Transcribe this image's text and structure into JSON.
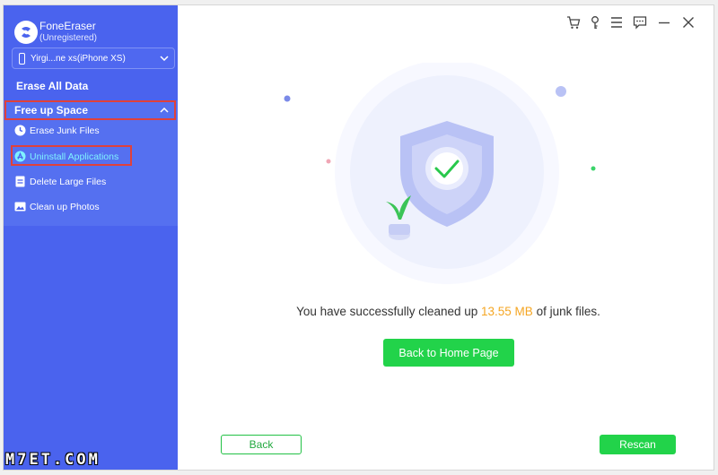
{
  "app": {
    "name": "FoneEraser",
    "status": "(Unregistered)"
  },
  "device": {
    "selected": "Yirgi...ne xs(iPhone XS)"
  },
  "sidebar": {
    "erase_all": "Erase All Data",
    "free_up": "Free up Space",
    "items": [
      {
        "label": "Erase Junk Files",
        "icon": "clock-icon"
      },
      {
        "label": "Uninstall Applications",
        "icon": "app-store-icon"
      },
      {
        "label": "Delete Large Files",
        "icon": "file-icon"
      },
      {
        "label": "Clean up Photos",
        "icon": "photo-icon"
      }
    ]
  },
  "toolbar": {
    "icons": [
      "cart-icon",
      "key-icon",
      "menu-icon",
      "feedback-icon",
      "minimize-icon",
      "close-icon"
    ]
  },
  "result": {
    "prefix": "You have successfully cleaned up ",
    "amount": "13.55 MB",
    "suffix": " of junk files."
  },
  "buttons": {
    "home": "Back to Home Page",
    "back": "Back",
    "rescan": "Rescan"
  },
  "watermark": "M7ET.COM",
  "colors": {
    "sidebar": "#4a63ee",
    "accent_green": "#22d34a",
    "amount": "#f5a623",
    "highlight_box": "#e0413a"
  }
}
